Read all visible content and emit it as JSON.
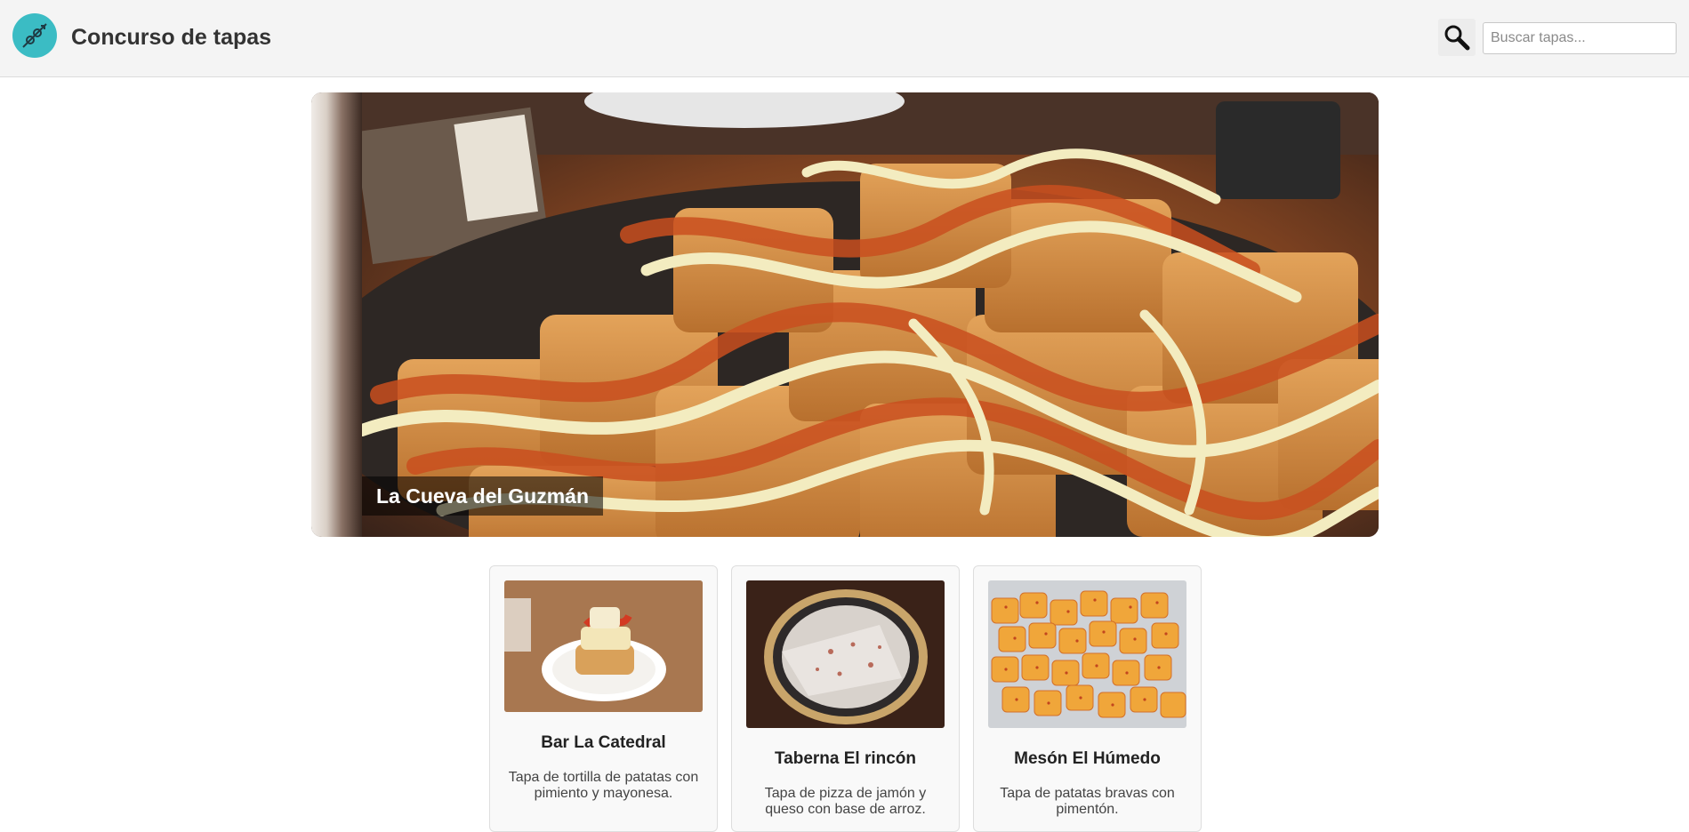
{
  "header": {
    "logo_icon": "skewer-icon",
    "logo_color": "#3bbcc4",
    "title": "Concurso de tapas",
    "search_icon": "search-icon",
    "search_placeholder": "Buscar tapas...",
    "search_value": ""
  },
  "hero": {
    "image": "patatas-bravas-photo",
    "caption": "La Cueva del Guzmán"
  },
  "cards": [
    {
      "image": "tortilla-tapa-photo",
      "title": "Bar La Catedral",
      "description": "Tapa de tortilla de patatas con pimiento y mayonesa."
    },
    {
      "image": "pizza-tapa-photo",
      "title": "Taberna El rincón",
      "description": "Tapa de pizza de jamón y queso con base de arroz."
    },
    {
      "image": "bravas-tapa-photo",
      "title": "Mesón El Húmedo",
      "description": "Tapa de patatas bravas con pimentón."
    }
  ]
}
